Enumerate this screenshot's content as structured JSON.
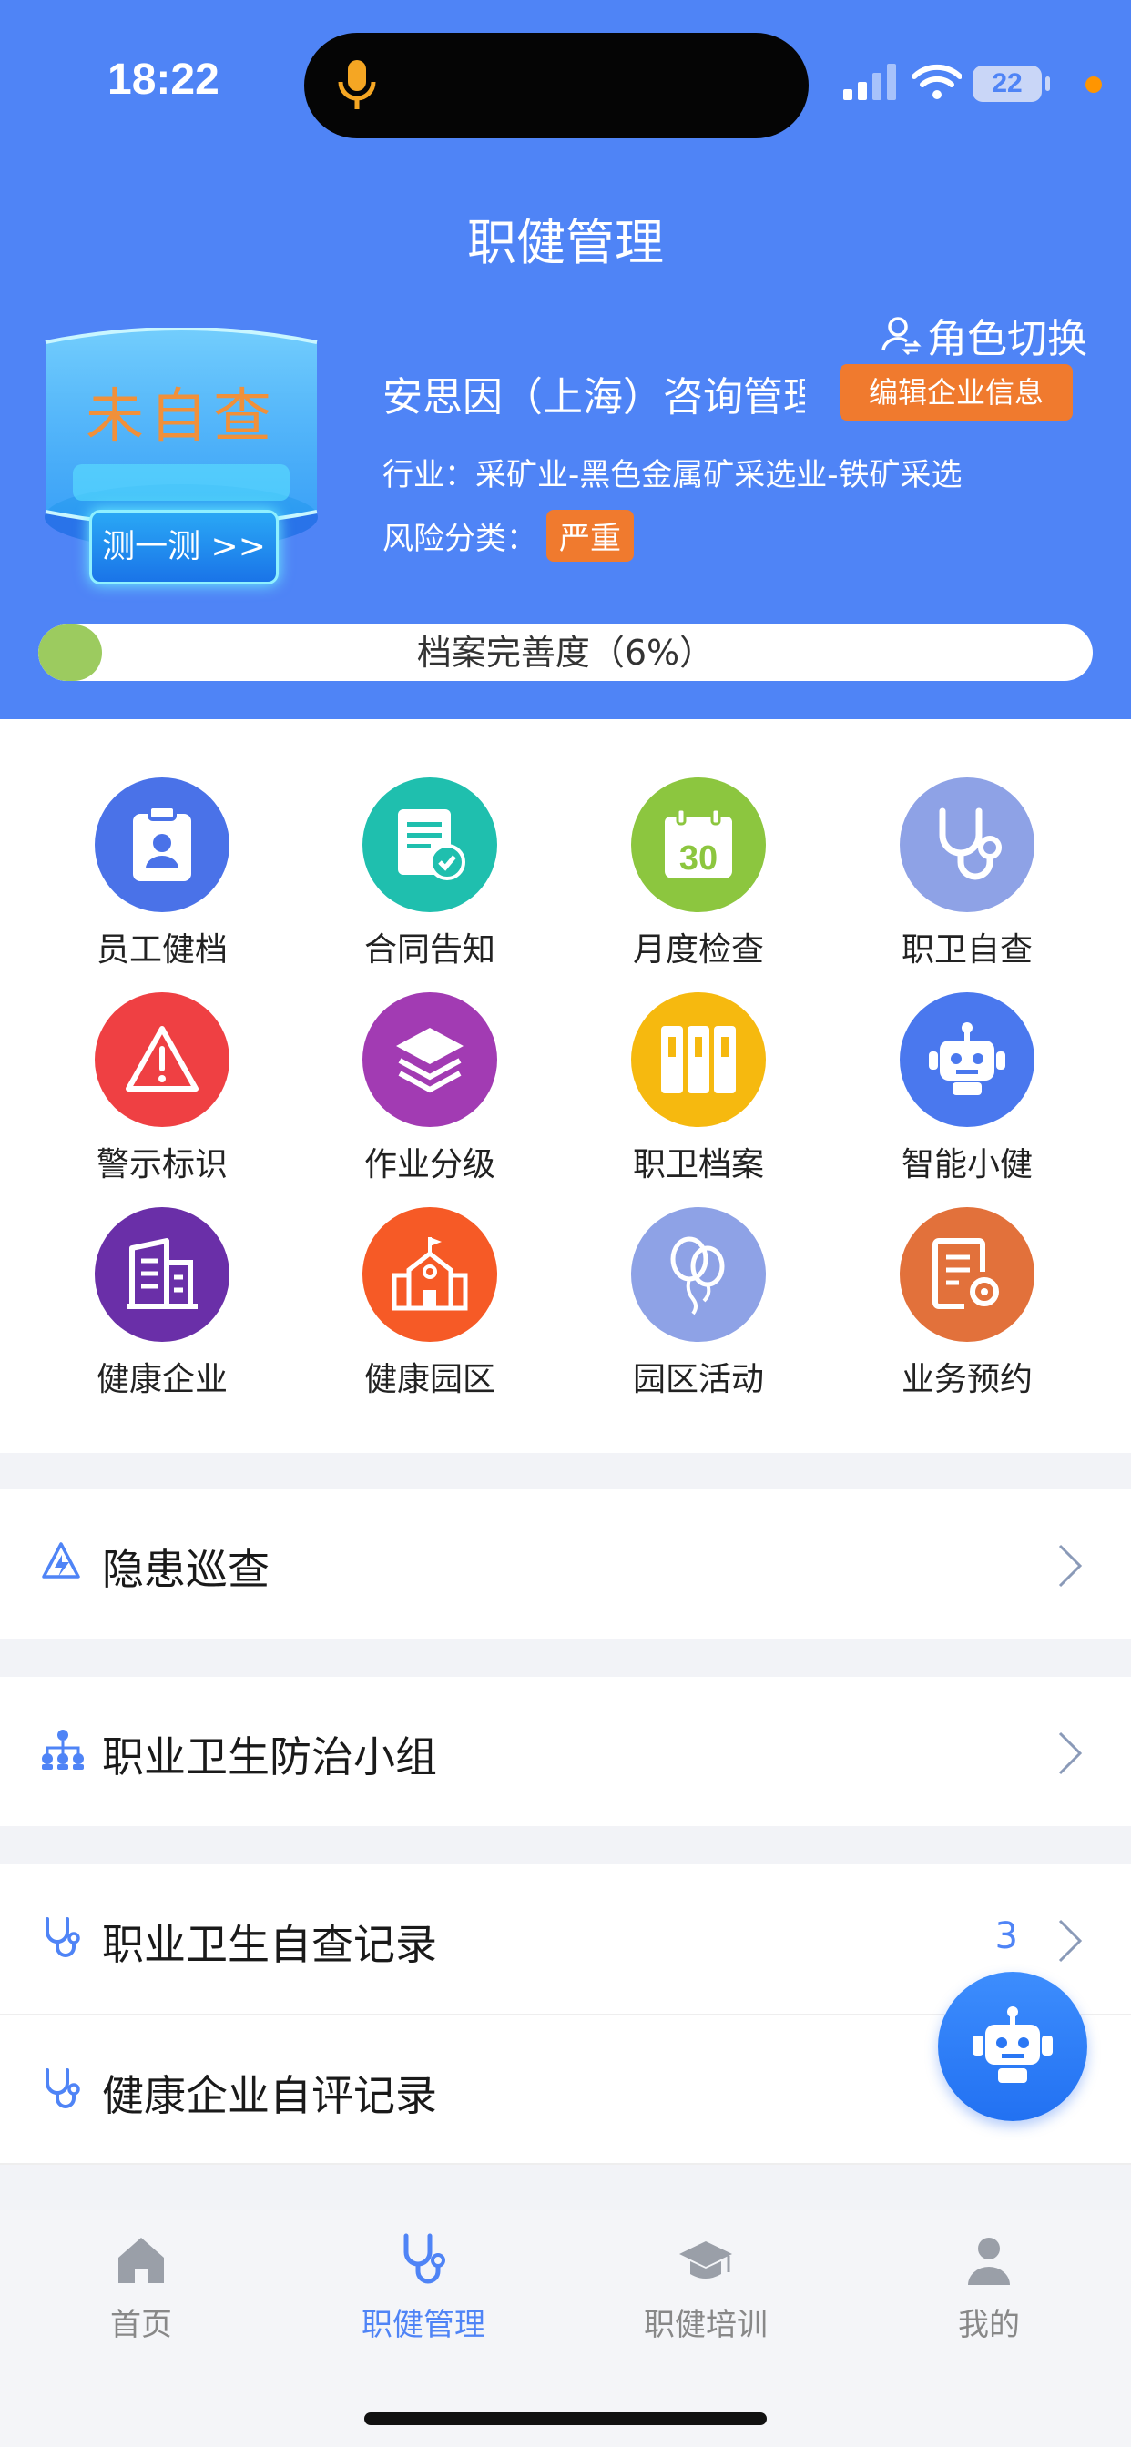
{
  "status_bar": {
    "time": "18:22",
    "battery": "22"
  },
  "page_title": "职健管理",
  "role_switch": "角色切换",
  "badge": {
    "status": "未自查",
    "test_button": "测一测 >>"
  },
  "company": {
    "name": "安思因（上海）咨询管理",
    "edit_button": "编辑企业信息",
    "industry_label": "行业：",
    "industry_value": "采矿业-黑色金属矿采选业-铁矿采选",
    "risk_label": "风险分类：",
    "risk_value": "严重"
  },
  "progress": {
    "label": "档案完善度（6%）",
    "value": 0.06
  },
  "grid": [
    {
      "label": "员工健档",
      "icon": "employee-badge-icon",
      "color": "#4a72e8"
    },
    {
      "label": "合同告知",
      "icon": "contract-document-icon",
      "color": "#1fbfae"
    },
    {
      "label": "月度检查",
      "icon": "calendar-30-icon",
      "color": "#8cc63f"
    },
    {
      "label": "职卫自查",
      "icon": "stethoscope-icon",
      "color": "#8ea2e6"
    },
    {
      "label": "警示标识",
      "icon": "warning-triangle-icon",
      "color": "#ef4043"
    },
    {
      "label": "作业分级",
      "icon": "layers-icon",
      "color": "#a23bb3"
    },
    {
      "label": "职卫档案",
      "icon": "binders-icon",
      "color": "#f6b90f"
    },
    {
      "label": "智能小健",
      "icon": "robot-icon",
      "color": "#4a78ee"
    },
    {
      "label": "健康企业",
      "icon": "building-icon",
      "color": "#6a2fa8"
    },
    {
      "label": "健康园区",
      "icon": "school-building-icon",
      "color": "#f65a26"
    },
    {
      "label": "园区活动",
      "icon": "balloons-icon",
      "color": "#8ea2e6"
    },
    {
      "label": "业务预约",
      "icon": "document-gear-icon",
      "color": "#e2713b"
    }
  ],
  "list": [
    {
      "label": "隐患巡查",
      "icon": "hazard-patrol-icon",
      "count": ""
    },
    {
      "label": "职业卫生防治小组",
      "icon": "team-tree-icon",
      "count": ""
    },
    {
      "label": "职业卫生自查记录",
      "icon": "stethoscope-icon",
      "count": "3"
    },
    {
      "label": "健康企业自评记录",
      "icon": "stethoscope-icon",
      "count": ""
    }
  ],
  "tabs": [
    {
      "label": "首页",
      "icon": "home-icon",
      "active": false
    },
    {
      "label": "职健管理",
      "icon": "stethoscope-icon",
      "active": true
    },
    {
      "label": "职健培训",
      "icon": "graduation-cap-icon",
      "active": false
    },
    {
      "label": "我的",
      "icon": "user-icon",
      "active": false
    }
  ],
  "colors": {
    "primary": "#4f84f6",
    "accent_orange": "#f07a2e",
    "progress_green": "#9ccb5f"
  }
}
